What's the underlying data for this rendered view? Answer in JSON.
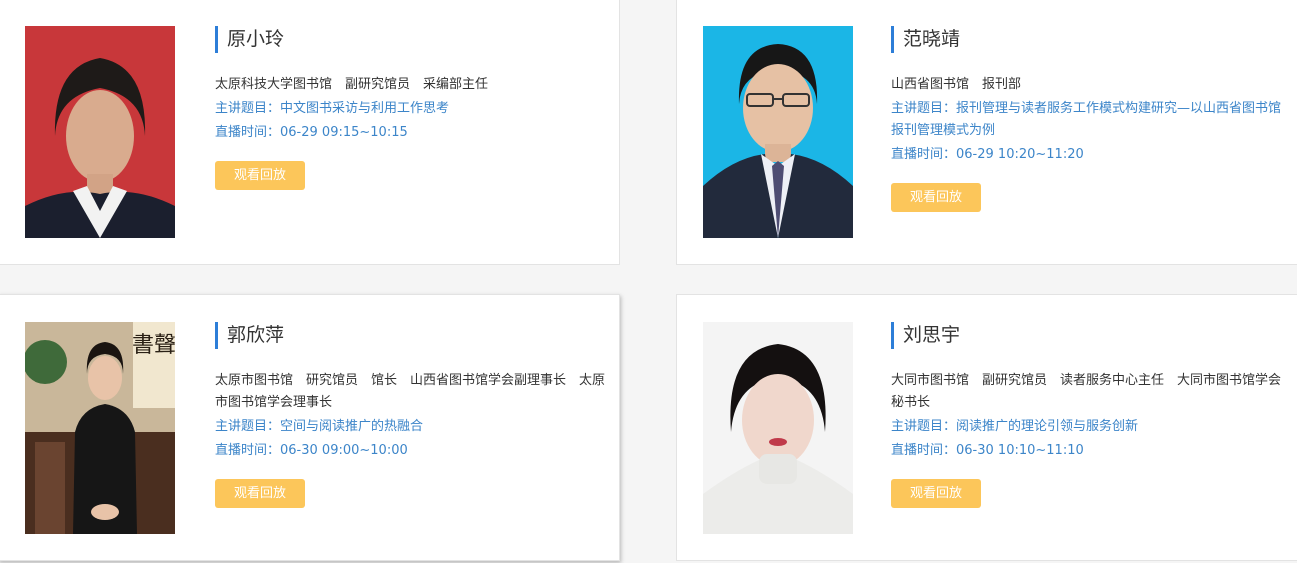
{
  "cards": [
    {
      "name": "原小玲",
      "org": "太原科技大学图书馆　副研究馆员　采编部主任",
      "topic_label": "主讲题目：",
      "topic": "中文图书采访与利用工作思考",
      "time_label": "直播时间：",
      "time": "06-29 09:15~10:15",
      "button": "观看回放"
    },
    {
      "name": "范晓靖",
      "org": "山西省图书馆　报刊部",
      "topic_label": "主讲题目：",
      "topic": "报刊管理与读者服务工作模式构建研究—以山西省图书馆报刊管理模式为例",
      "time_label": "直播时间：",
      "time": "06-29 10:20~11:20",
      "button": "观看回放"
    },
    {
      "name": "郭欣萍",
      "org": "太原市图书馆　研究馆员　馆长　山西省图书馆学会副理事长　太原市图书馆学会理事长",
      "topic_label": "主讲题目：",
      "topic": "空间与阅读推广的热融合",
      "time_label": "直播时间：",
      "time": "06-30 09:00~10:00",
      "button": "观看回放"
    },
    {
      "name": "刘思宇",
      "org": "大同市图书馆　副研究馆员　读者服务中心主任　大同市图书馆学会秘书长",
      "topic_label": "主讲题目：",
      "topic": "阅读推广的理论引领与服务创新",
      "time_label": "直播时间：",
      "time": "06-30 10:10~11:10",
      "button": "观看回放"
    }
  ],
  "photo_calligraphy": "書聲",
  "colors": {
    "accent_bar": "#2d7ed8",
    "link_text": "#3c85c9",
    "button_bg": "#fcc65a"
  }
}
